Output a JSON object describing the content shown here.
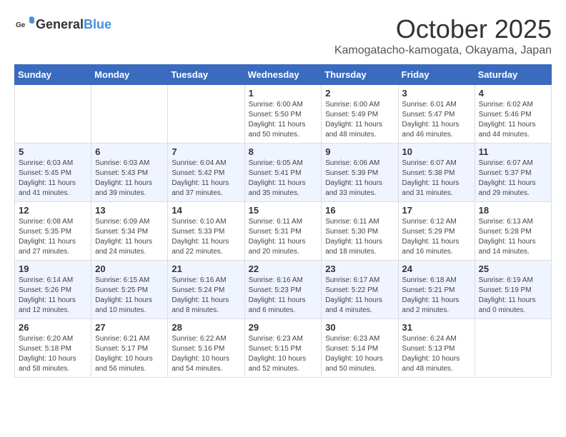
{
  "header": {
    "logo_general": "General",
    "logo_blue": "Blue",
    "month": "October 2025",
    "location": "Kamogatacho-kamogata, Okayama, Japan"
  },
  "weekdays": [
    "Sunday",
    "Monday",
    "Tuesday",
    "Wednesday",
    "Thursday",
    "Friday",
    "Saturday"
  ],
  "weeks": [
    [
      {
        "day": "",
        "sunrise": "",
        "sunset": "",
        "daylight": ""
      },
      {
        "day": "",
        "sunrise": "",
        "sunset": "",
        "daylight": ""
      },
      {
        "day": "",
        "sunrise": "",
        "sunset": "",
        "daylight": ""
      },
      {
        "day": "1",
        "sunrise": "Sunrise: 6:00 AM",
        "sunset": "Sunset: 5:50 PM",
        "daylight": "Daylight: 11 hours and 50 minutes."
      },
      {
        "day": "2",
        "sunrise": "Sunrise: 6:00 AM",
        "sunset": "Sunset: 5:49 PM",
        "daylight": "Daylight: 11 hours and 48 minutes."
      },
      {
        "day": "3",
        "sunrise": "Sunrise: 6:01 AM",
        "sunset": "Sunset: 5:47 PM",
        "daylight": "Daylight: 11 hours and 46 minutes."
      },
      {
        "day": "4",
        "sunrise": "Sunrise: 6:02 AM",
        "sunset": "Sunset: 5:46 PM",
        "daylight": "Daylight: 11 hours and 44 minutes."
      }
    ],
    [
      {
        "day": "5",
        "sunrise": "Sunrise: 6:03 AM",
        "sunset": "Sunset: 5:45 PM",
        "daylight": "Daylight: 11 hours and 41 minutes."
      },
      {
        "day": "6",
        "sunrise": "Sunrise: 6:03 AM",
        "sunset": "Sunset: 5:43 PM",
        "daylight": "Daylight: 11 hours and 39 minutes."
      },
      {
        "day": "7",
        "sunrise": "Sunrise: 6:04 AM",
        "sunset": "Sunset: 5:42 PM",
        "daylight": "Daylight: 11 hours and 37 minutes."
      },
      {
        "day": "8",
        "sunrise": "Sunrise: 6:05 AM",
        "sunset": "Sunset: 5:41 PM",
        "daylight": "Daylight: 11 hours and 35 minutes."
      },
      {
        "day": "9",
        "sunrise": "Sunrise: 6:06 AM",
        "sunset": "Sunset: 5:39 PM",
        "daylight": "Daylight: 11 hours and 33 minutes."
      },
      {
        "day": "10",
        "sunrise": "Sunrise: 6:07 AM",
        "sunset": "Sunset: 5:38 PM",
        "daylight": "Daylight: 11 hours and 31 minutes."
      },
      {
        "day": "11",
        "sunrise": "Sunrise: 6:07 AM",
        "sunset": "Sunset: 5:37 PM",
        "daylight": "Daylight: 11 hours and 29 minutes."
      }
    ],
    [
      {
        "day": "12",
        "sunrise": "Sunrise: 6:08 AM",
        "sunset": "Sunset: 5:35 PM",
        "daylight": "Daylight: 11 hours and 27 minutes."
      },
      {
        "day": "13",
        "sunrise": "Sunrise: 6:09 AM",
        "sunset": "Sunset: 5:34 PM",
        "daylight": "Daylight: 11 hours and 24 minutes."
      },
      {
        "day": "14",
        "sunrise": "Sunrise: 6:10 AM",
        "sunset": "Sunset: 5:33 PM",
        "daylight": "Daylight: 11 hours and 22 minutes."
      },
      {
        "day": "15",
        "sunrise": "Sunrise: 6:11 AM",
        "sunset": "Sunset: 5:31 PM",
        "daylight": "Daylight: 11 hours and 20 minutes."
      },
      {
        "day": "16",
        "sunrise": "Sunrise: 6:11 AM",
        "sunset": "Sunset: 5:30 PM",
        "daylight": "Daylight: 11 hours and 18 minutes."
      },
      {
        "day": "17",
        "sunrise": "Sunrise: 6:12 AM",
        "sunset": "Sunset: 5:29 PM",
        "daylight": "Daylight: 11 hours and 16 minutes."
      },
      {
        "day": "18",
        "sunrise": "Sunrise: 6:13 AM",
        "sunset": "Sunset: 5:28 PM",
        "daylight": "Daylight: 11 hours and 14 minutes."
      }
    ],
    [
      {
        "day": "19",
        "sunrise": "Sunrise: 6:14 AM",
        "sunset": "Sunset: 5:26 PM",
        "daylight": "Daylight: 11 hours and 12 minutes."
      },
      {
        "day": "20",
        "sunrise": "Sunrise: 6:15 AM",
        "sunset": "Sunset: 5:25 PM",
        "daylight": "Daylight: 11 hours and 10 minutes."
      },
      {
        "day": "21",
        "sunrise": "Sunrise: 6:16 AM",
        "sunset": "Sunset: 5:24 PM",
        "daylight": "Daylight: 11 hours and 8 minutes."
      },
      {
        "day": "22",
        "sunrise": "Sunrise: 6:16 AM",
        "sunset": "Sunset: 5:23 PM",
        "daylight": "Daylight: 11 hours and 6 minutes."
      },
      {
        "day": "23",
        "sunrise": "Sunrise: 6:17 AM",
        "sunset": "Sunset: 5:22 PM",
        "daylight": "Daylight: 11 hours and 4 minutes."
      },
      {
        "day": "24",
        "sunrise": "Sunrise: 6:18 AM",
        "sunset": "Sunset: 5:21 PM",
        "daylight": "Daylight: 11 hours and 2 minutes."
      },
      {
        "day": "25",
        "sunrise": "Sunrise: 6:19 AM",
        "sunset": "Sunset: 5:19 PM",
        "daylight": "Daylight: 11 hours and 0 minutes."
      }
    ],
    [
      {
        "day": "26",
        "sunrise": "Sunrise: 6:20 AM",
        "sunset": "Sunset: 5:18 PM",
        "daylight": "Daylight: 10 hours and 58 minutes."
      },
      {
        "day": "27",
        "sunrise": "Sunrise: 6:21 AM",
        "sunset": "Sunset: 5:17 PM",
        "daylight": "Daylight: 10 hours and 56 minutes."
      },
      {
        "day": "28",
        "sunrise": "Sunrise: 6:22 AM",
        "sunset": "Sunset: 5:16 PM",
        "daylight": "Daylight: 10 hours and 54 minutes."
      },
      {
        "day": "29",
        "sunrise": "Sunrise: 6:23 AM",
        "sunset": "Sunset: 5:15 PM",
        "daylight": "Daylight: 10 hours and 52 minutes."
      },
      {
        "day": "30",
        "sunrise": "Sunrise: 6:23 AM",
        "sunset": "Sunset: 5:14 PM",
        "daylight": "Daylight: 10 hours and 50 minutes."
      },
      {
        "day": "31",
        "sunrise": "Sunrise: 6:24 AM",
        "sunset": "Sunset: 5:13 PM",
        "daylight": "Daylight: 10 hours and 48 minutes."
      },
      {
        "day": "",
        "sunrise": "",
        "sunset": "",
        "daylight": ""
      }
    ]
  ]
}
